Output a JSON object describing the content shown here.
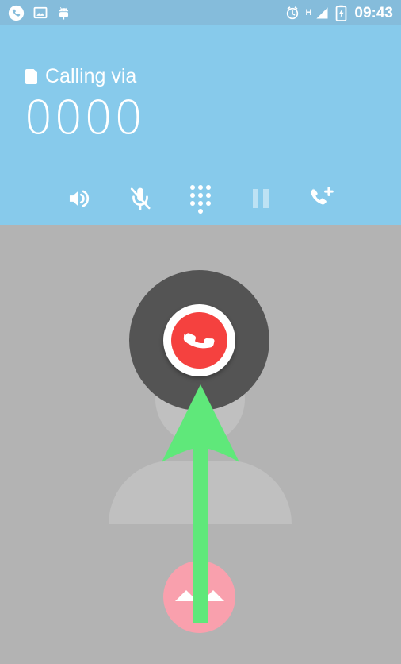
{
  "status_bar": {
    "background_color": "#85bcdb",
    "left_icons": [
      {
        "name": "phone-in-call-icon",
        "label": "In call"
      },
      {
        "name": "image-notification-icon",
        "label": "Screenshot"
      },
      {
        "name": "android-debug-icon",
        "label": "USB debugging"
      }
    ],
    "right": {
      "alarm_icon": "alarm-icon",
      "network_type": "H",
      "signal_icon": "signal-bars-icon",
      "battery_icon": "battery-charging-icon",
      "time": "09:43"
    }
  },
  "header": {
    "background_color": "#87caeb",
    "sim_icon": "sim-card-icon",
    "calling_via_label": "Calling via",
    "number": "0000",
    "actions": [
      {
        "name": "speaker-button",
        "icon": "speaker-icon",
        "label": "Speaker",
        "enabled": true
      },
      {
        "name": "mute-button",
        "icon": "mic-off-icon",
        "label": "Mute",
        "enabled": true
      },
      {
        "name": "dialpad-button",
        "icon": "dialpad-icon",
        "label": "Dialpad",
        "enabled": true
      },
      {
        "name": "hold-button",
        "icon": "pause-icon",
        "label": "Hold",
        "enabled": false
      },
      {
        "name": "add-call-button",
        "icon": "add-call-icon",
        "label": "Add call",
        "enabled": true
      }
    ]
  },
  "body": {
    "background_color": "#b3b3b3",
    "avatar": {
      "name": "contact-avatar-silhouette",
      "color": "#c0c0c0"
    },
    "end_call": {
      "name": "end-call-button",
      "outer_color": "#545454",
      "ring_color": "#ffffff",
      "inner_color": "#f5413f",
      "icon": "phone-hangup-icon",
      "label": "End call"
    },
    "expand_handle": {
      "name": "expand-handle-button",
      "color": "#f9a0ad",
      "icon": "chevron-expand-icon",
      "label": "Swipe up"
    },
    "annotation_arrow": {
      "name": "swipe-up-arrow",
      "color": "#5fe87a",
      "direction": "up"
    }
  }
}
